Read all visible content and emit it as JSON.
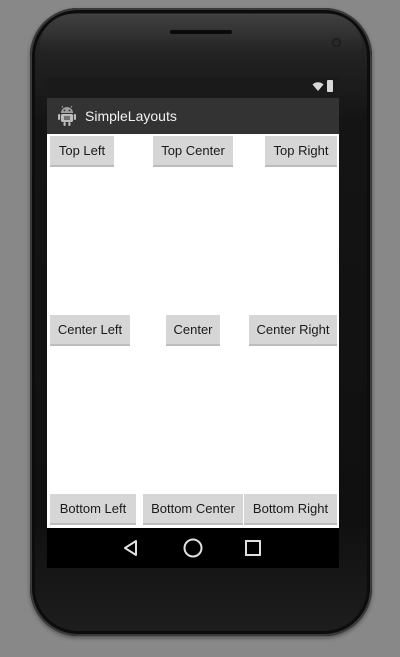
{
  "app": {
    "title": "SimpleLayouts",
    "icon": "android-robot-icon"
  },
  "status_bar": {
    "icons": [
      "wifi-icon",
      "battery-icon"
    ]
  },
  "buttons": {
    "top_left": "Top Left",
    "top_center": "Top Center",
    "top_right": "Top Right",
    "center_left": "Center Left",
    "center": "Center",
    "center_right": "Center Right",
    "bottom_left": "Bottom Left",
    "bottom_center": "Bottom Center",
    "bottom_right": "Bottom Right"
  },
  "navigation": {
    "icons": [
      "back-icon",
      "home-icon",
      "recents-icon"
    ]
  },
  "colors": {
    "background": "#888888",
    "action_bar": "#333333",
    "button": "#d6d6d6",
    "content": "#ffffff"
  }
}
